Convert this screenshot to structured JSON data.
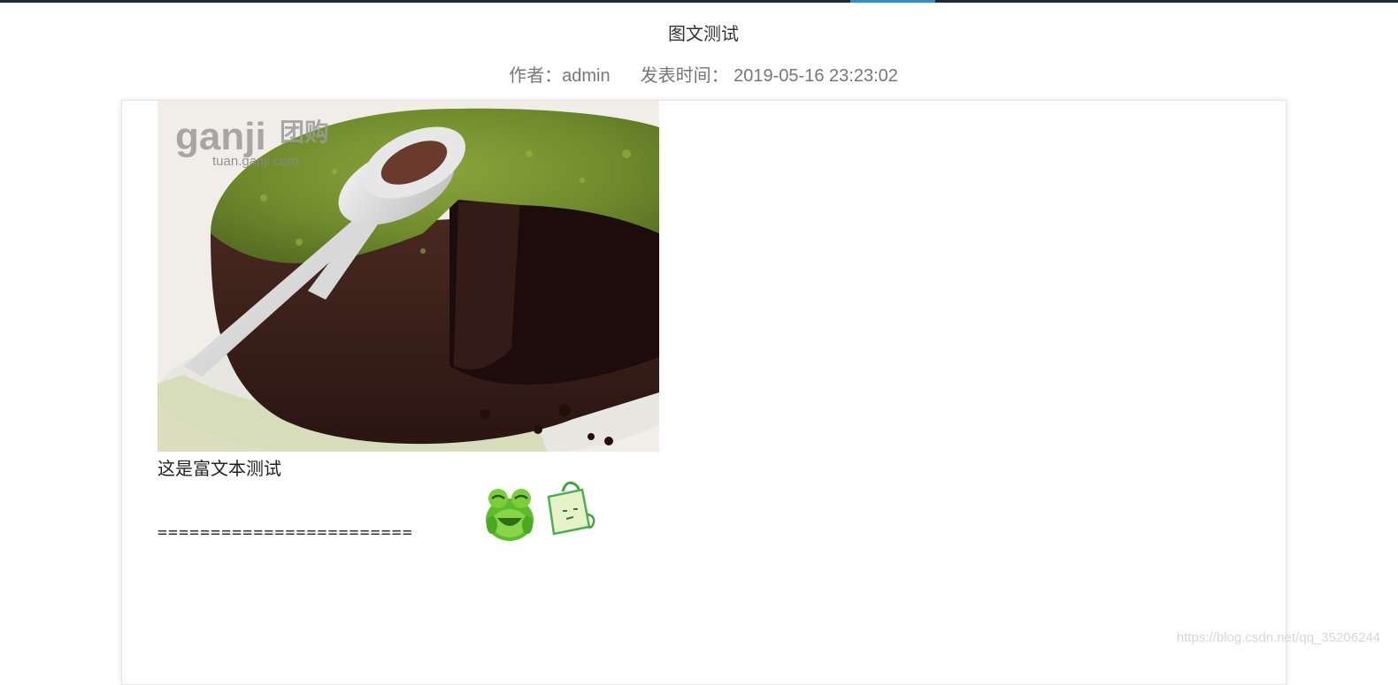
{
  "article": {
    "title": "图文测试",
    "author_label": "作者：",
    "author": "admin",
    "time_label": "发表时间：",
    "time": "2019-05-16 23:23:02"
  },
  "content": {
    "image_watermark_logo": "ganji团购",
    "image_watermark_url": "tuan.ganji.com",
    "rich_text": "这是富文本测试",
    "separator": "========================",
    "emojis": [
      "frog-laughing-emoji",
      "shopping-bag-emoji"
    ]
  },
  "page_watermark": "https://blog.csdn.net/qq_35206244",
  "colors": {
    "topbar": "#1d2b33",
    "topbar_active": "#2e8fd6",
    "meta_text": "#777777"
  }
}
